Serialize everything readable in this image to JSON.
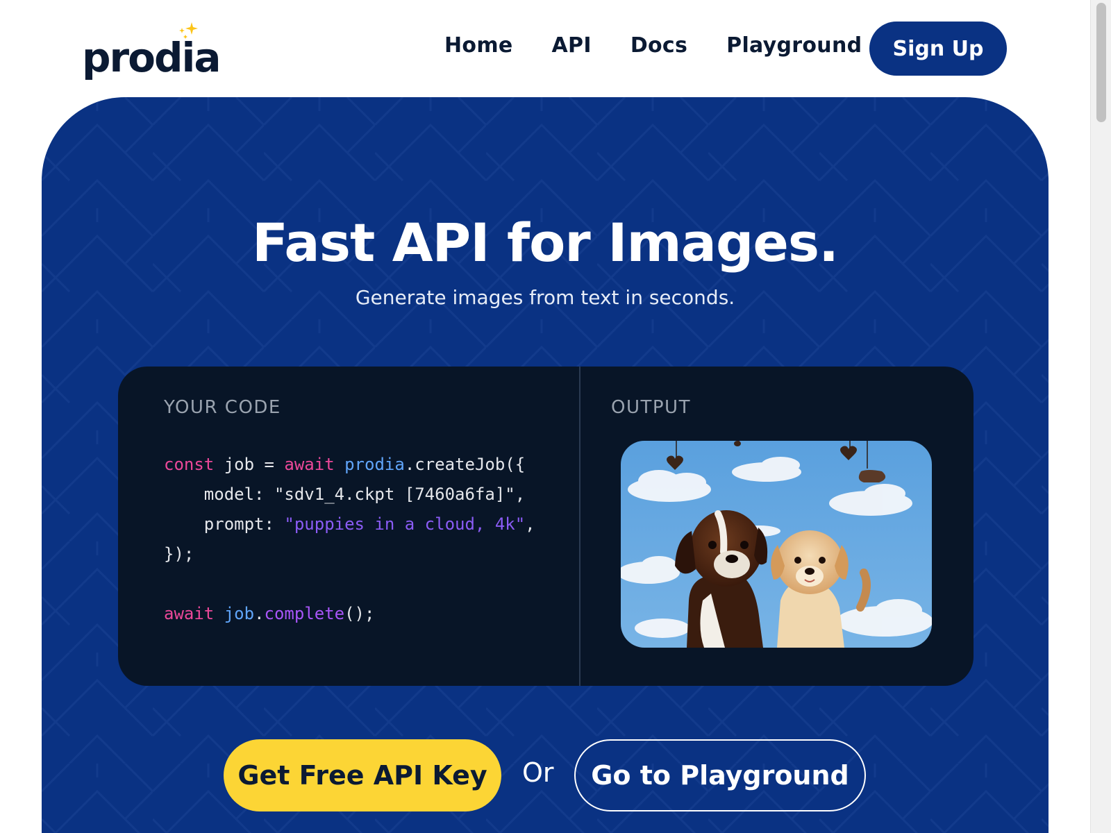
{
  "header": {
    "logo_text": "prodia",
    "nav": [
      {
        "label": "Home"
      },
      {
        "label": "API"
      },
      {
        "label": "Docs"
      },
      {
        "label": "Playground"
      }
    ],
    "signup_label": "Sign Up"
  },
  "hero": {
    "title": "Fast API for Images.",
    "subtitle": "Generate images from text in seconds.",
    "code_label": "YOUR CODE",
    "output_label": "OUTPUT",
    "code": {
      "line1": {
        "kw": "const",
        "a": " job = ",
        "kw2": "await",
        "sp": " ",
        "obj": "prodia",
        "b": ".createJob({"
      },
      "line2": {
        "a": "    model: \"sdv1_4.ckpt [7460a6fa]\","
      },
      "line3": {
        "a": "    prompt: ",
        "str": "\"puppies in a cloud, 4k\"",
        "b": ","
      },
      "line4": {
        "a": "});"
      },
      "line6": {
        "kw": "await",
        "sp": " ",
        "obj": "job",
        "dot": ".",
        "fn": "complete",
        "b": "();"
      }
    },
    "output_image_icon": "puppies-in-clouds-image",
    "cta_primary": "Get Free API Key",
    "cta_or": "Or",
    "cta_secondary": "Go to Playground"
  },
  "colors": {
    "brand_blue": "#0a3283",
    "accent_yellow": "#fcd535",
    "code_bg": "#081527"
  }
}
